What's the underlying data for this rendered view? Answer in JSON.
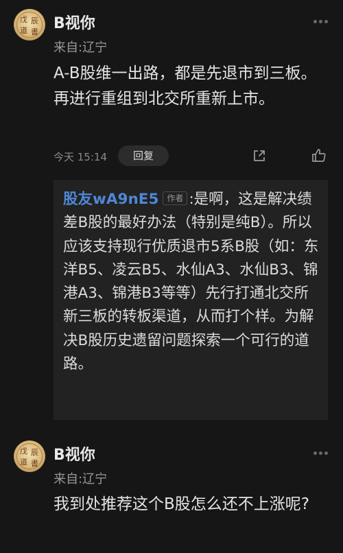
{
  "comments": [
    {
      "username": "B视你",
      "location": "来自:辽宁",
      "text": "A-B股维一出路，都是先退市到三板。再进行重组到北交所重新上市。",
      "time": "今天 15:14",
      "reply_label": "回复",
      "avatar_icon": "calligraphy-avatar",
      "more_icon": "more-dots-icon",
      "share_icon": "share-icon",
      "like_icon": "thumbs-up-icon",
      "quoted_reply": {
        "username": "股友wA9nE5",
        "tag": "作者",
        "text": ":是啊，这是解决绩差B股的最好办法（特别是纯B）。所以应该支持现行优质退市5系B股（如：东洋B5、凌云B5、水仙A3、水仙B3、锦港A3、锦港B3等等）先行打通北交所新三板的转板渠道，从而打个样。为解决B股历史遗留问题探索一个可行的道路。"
      }
    },
    {
      "username": "B视你",
      "location": "来自:辽宁",
      "text": "我到处推荐这个B股怎么还不上涨呢?",
      "avatar_icon": "calligraphy-avatar",
      "more_icon": "more-dots-icon"
    }
  ],
  "colors": {
    "background": "#161616",
    "quote_background": "#222222",
    "link_blue": "#4f87d6",
    "muted": "#9a9a9a"
  }
}
